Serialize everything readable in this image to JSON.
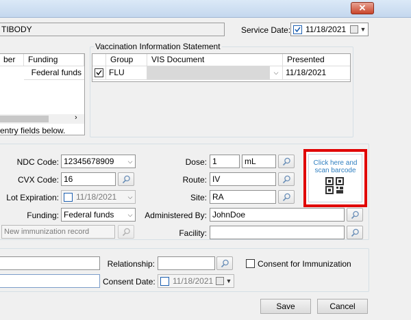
{
  "window": {
    "close_label": "✕"
  },
  "header": {
    "vaccine_name": "TIBODY",
    "service_date_label": "Service Date:",
    "service_date": "11/18/2021"
  },
  "left_grid": {
    "headers": [
      "ber",
      "Funding"
    ],
    "row": {
      "funding": "Federal funds"
    },
    "hint": "entry fields below."
  },
  "vis": {
    "legend": "Vaccination Information Statement",
    "headers": {
      "group": "Group",
      "document": "VIS Document",
      "presented": "Presented"
    },
    "row": {
      "group": "FLU",
      "document": "",
      "presented": "11/18/2021"
    }
  },
  "form": {
    "ndc_label": "NDC Code:",
    "ndc_value": "12345678909",
    "cvx_label": "CVX Code:",
    "cvx_value": "16",
    "lot_exp_label": "Lot Expiration:",
    "lot_exp_value": "11/18/2021",
    "funding_label": "Funding:",
    "funding_value": "Federal funds",
    "new_record": "New immunization record",
    "dose_label": "Dose:",
    "dose_value": "1",
    "dose_unit": "mL",
    "route_label": "Route:",
    "route_value": "IV",
    "site_label": "Site:",
    "site_value": "RA",
    "admin_label": "Administered By:",
    "admin_value": "JohnDoe",
    "facility_label": "Facility:",
    "facility_value": ""
  },
  "barcode": {
    "line1": "Click here and",
    "line2": "scan barcode",
    "highlight_color": "#e00000"
  },
  "consent": {
    "relationship_label": "Relationship:",
    "consent_checkbox_label": "Consent for Immunization",
    "consent_date_label": "Consent Date:",
    "consent_date_value": "11/18/2021"
  },
  "footer": {
    "save_label": "Save",
    "cancel_label": "Cancel"
  }
}
